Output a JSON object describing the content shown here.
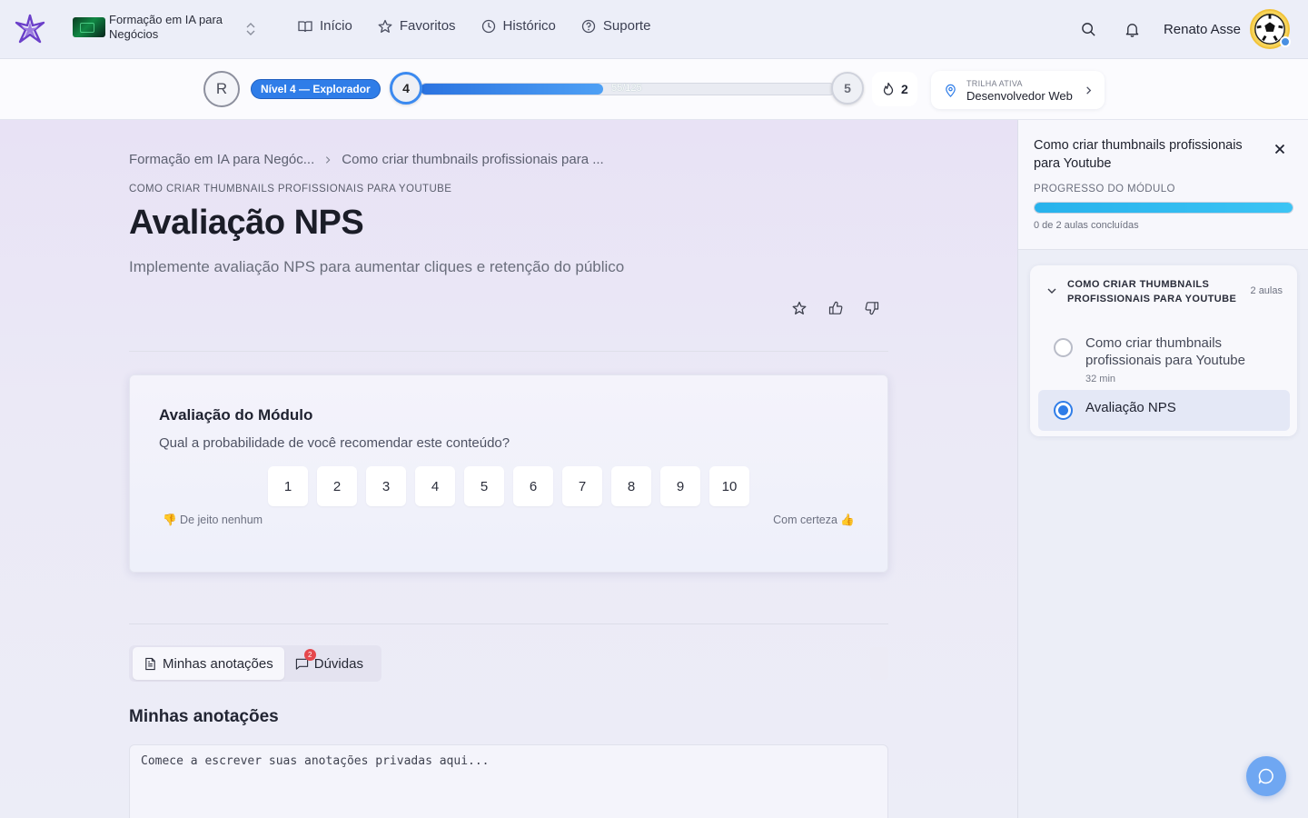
{
  "nav": {
    "course_title": "Formação em IA para Negócios",
    "links": [
      {
        "label": "Início",
        "icon": "book-open-icon"
      },
      {
        "label": "Favoritos",
        "icon": "star-icon"
      },
      {
        "label": "Histórico",
        "icon": "clock-icon"
      },
      {
        "label": "Suporte",
        "icon": "help-circle-icon"
      }
    ],
    "user_name": "Renato Asse"
  },
  "progress": {
    "avatar_initial": "R",
    "level_label": "Nível 4 — Explorador",
    "current_level": "4",
    "next_level": "5",
    "xp_text": "55/125",
    "xp_fraction": 0.44,
    "streak": "2",
    "trail_label": "TRILHA ATIVA",
    "trail_value": "Desenvolvedor Web"
  },
  "breadcrumb": {
    "items": [
      "Formação em IA para Negóc...",
      "Como criar thumbnails profissionais para ..."
    ]
  },
  "lesson": {
    "overline": "COMO CRIAR THUMBNAILS PROFISSIONAIS PARA YOUTUBE",
    "title": "Avaliação NPS",
    "subtitle": "Implemente avaliação NPS para aumentar cliques e retenção do público"
  },
  "nps": {
    "title": "Avaliação do Módulo",
    "question": "Qual a probabilidade de você recomendar este conteúdo?",
    "scale": [
      "1",
      "2",
      "3",
      "4",
      "5",
      "6",
      "7",
      "8",
      "9",
      "10"
    ],
    "low_label": "👎 De jeito nenhum",
    "high_label": "Com certeza 👍"
  },
  "tabs": {
    "notes": "Minhas anotações",
    "questions": "Dúvidas",
    "questions_badge": "2"
  },
  "notes": {
    "title": "Minhas anotações",
    "placeholder": "Comece a escrever suas anotações privadas aqui..."
  },
  "sidebar": {
    "title": "Como criar thumbnails profissionais para Youtube",
    "progress_label": "PROGRESSO DO MÓDULO",
    "progress_text": "0 de 2 aulas concluídas",
    "progress_fraction": 1.0,
    "module": {
      "title": "COMO CRIAR THUMBNAILS PROFISSIONAIS PARA YOUTUBE",
      "count": "2 aulas",
      "lessons": [
        {
          "name": "Como criar thumbnails profissionais para Youtube",
          "duration": "32 min",
          "active": false
        },
        {
          "name": "Avaliação NPS",
          "duration": "",
          "active": true
        }
      ]
    }
  },
  "colors": {
    "accent": "#2f7de8",
    "progress_cyan": "#27b2ec",
    "brand_purple": "#6b3fc9"
  }
}
